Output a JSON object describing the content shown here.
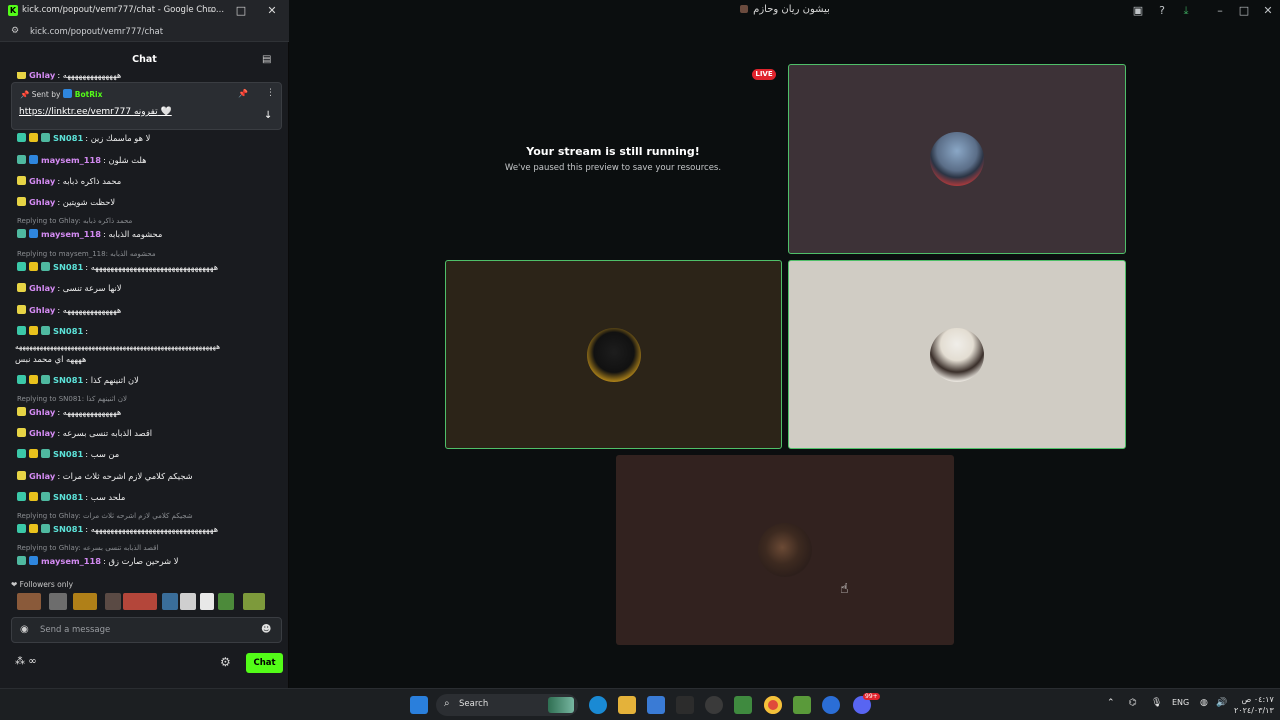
{
  "main_window": {
    "title": "بيشون ريان وحازم",
    "live_badge": "LIVE",
    "notice_title": "Your stream is still running!",
    "notice_subtitle": "We've paused this preview to save your resources."
  },
  "chat_window": {
    "title": "kick.com/popout/vemr777/chat - Google Chro...",
    "url": "kick.com/popout/vemr777/chat",
    "header": "Chat",
    "pinned": {
      "sent_by": "Sent by",
      "bot_name": "BotRix",
      "link": "https://linktr.ee/vemr777",
      "text": "تفرونه 🤍"
    },
    "messages": [
      {
        "user": "SN081",
        "text": "لا هو ماسمك زين"
      },
      {
        "user": "maysem_118",
        "text": "هلث شلون"
      },
      {
        "user": "Ghlay",
        "text": "محمد ذاكره ذبابه"
      },
      {
        "user": "Ghlay",
        "text": "لاحظت شويتين"
      },
      {
        "reply": "Replying to Ghlay: محمد ذاكره ذبابه",
        "user": "maysem_118",
        "text": "محشومه الذبابه"
      },
      {
        "reply": "Replying to maysem_118: محشومه الذبابه",
        "user": "SN081",
        "text": "ههههههههههههههههههههههههههههههههه"
      },
      {
        "user": "Ghlay",
        "text": "لانها سرعة تنسى"
      },
      {
        "user": "Ghlay",
        "text": "ههههههههههههههه"
      },
      {
        "user": "SN081",
        "text": "",
        "extra1": "ههههههههههههههههههههههههههههههههههههههههههههههههههههههههههه",
        "extra2": "ههههه اي محمد نبس"
      },
      {
        "user": "SN081",
        "text": "لان اثنينهم كذا"
      },
      {
        "reply": "Replying to SN081: لان اثنينهم كذا",
        "user": "Ghlay",
        "text": "ههههههههههههههه"
      },
      {
        "user": "Ghlay",
        "text": "اقصد الذبابه تنسى بسرعه"
      },
      {
        "user": "SN081",
        "text": "من سب"
      },
      {
        "user": "Ghlay",
        "text": "شجيكم كلامي لازم اشرحه ثلاث مرات"
      },
      {
        "user": "SN081",
        "text": "ملحد سب"
      },
      {
        "reply": "Replying to Ghlay: شجيكم كلامي لازم اشرحه ثلاث مرات",
        "user": "SN081",
        "text": "ههههههههههههههههههههههههههههههههه"
      },
      {
        "reply": "Replying to Ghlay: اقصد الذبابه تنسى بسرعه",
        "user": "maysem_118",
        "text": "لا شرحين صارت زق"
      }
    ],
    "top_partial": {
      "user": "Ghlay",
      "text": "ههههههههههههههه"
    },
    "followers_only": "Followers only",
    "input_placeholder": "Send a message",
    "footer_left": "∞",
    "send_label": "Chat"
  },
  "taskbar": {
    "search_label": "Search",
    "language": "ENG",
    "time": "٠٤:١٧ ص",
    "date": "٢٠٢٤/٠٣/١٣",
    "discord_badge": "99+"
  },
  "colors": {
    "kick_green": "#53fc18",
    "live_red": "#e0242d",
    "active_border": "#4fbf69"
  }
}
